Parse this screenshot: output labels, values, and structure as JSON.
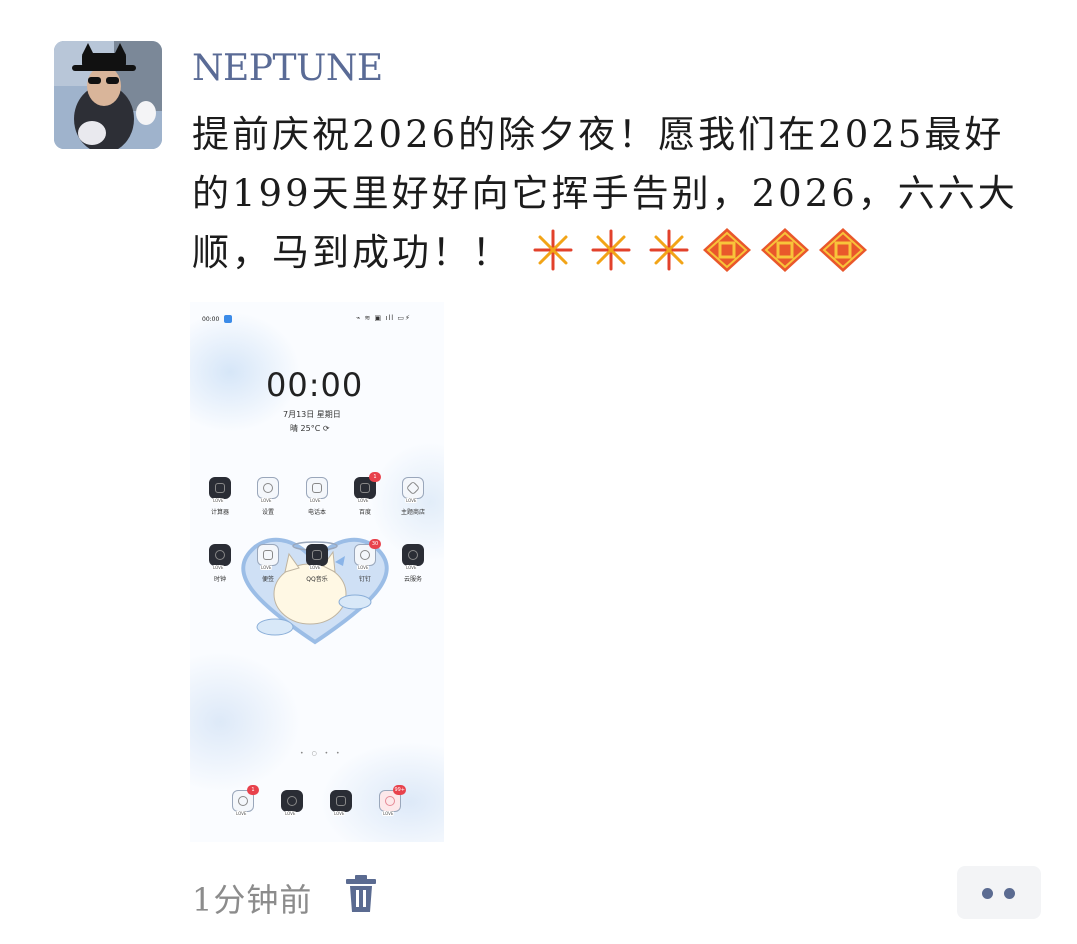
{
  "post": {
    "username": "NEPTUNE",
    "text": "提前庆祝2026的除夕夜！愿我们在2025最好的199天里好好向它挥手告别，2026，六六大顺，马到成功！！",
    "emojis": [
      "fireworks-icon",
      "fireworks-icon",
      "fireworks-icon",
      "fu-icon",
      "fu-icon",
      "fu-icon"
    ]
  },
  "screenshot": {
    "status_time": "00:00",
    "clock": "00:00",
    "date": "7月13日 星期日",
    "weather": "晴 25°C",
    "apps_row1": [
      {
        "label": "计算器",
        "icon": "calculator-icon",
        "dark": true,
        "badge": ""
      },
      {
        "label": "设置",
        "icon": "settings-icon",
        "dark": false,
        "badge": ""
      },
      {
        "label": "电话本",
        "icon": "contacts-icon",
        "dark": false,
        "badge": ""
      },
      {
        "label": "百度",
        "icon": "baidu-icon",
        "dark": true,
        "badge": "1"
      },
      {
        "label": "主题商店",
        "icon": "theme-store-icon",
        "dark": false,
        "badge": ""
      }
    ],
    "apps_row2": [
      {
        "label": "时钟",
        "icon": "clock-icon",
        "dark": true,
        "badge": ""
      },
      {
        "label": "便签",
        "icon": "notes-icon",
        "dark": false,
        "badge": ""
      },
      {
        "label": "QQ音乐",
        "icon": "music-icon",
        "dark": true,
        "badge": ""
      },
      {
        "label": "钉钉",
        "icon": "dingtalk-icon",
        "dark": false,
        "badge": "30"
      },
      {
        "label": "云服务",
        "icon": "cloud-icon",
        "dark": true,
        "badge": ""
      }
    ],
    "dock": [
      {
        "icon": "phone-icon",
        "dark": false,
        "badge": "1"
      },
      {
        "icon": "camera-icon",
        "dark": true,
        "badge": ""
      },
      {
        "icon": "gallery-icon",
        "dark": true,
        "badge": ""
      },
      {
        "icon": "messages-icon",
        "dark": false,
        "badge": "99+"
      }
    ],
    "page_dots": "• ○ • •"
  },
  "footer": {
    "time_ago": "1分钟前",
    "delete_icon": "trash-icon",
    "more_icon": "more-icon"
  },
  "colors": {
    "username": "#5a6b96",
    "footer_text": "#8c8c8c",
    "more_button_bg": "#f3f4f6",
    "badge": "#e8424c"
  }
}
